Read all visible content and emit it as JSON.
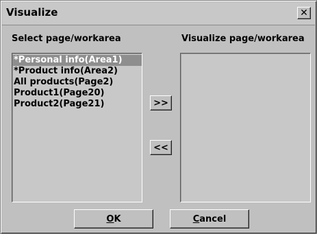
{
  "window": {
    "title": "Visualize",
    "close_icon": "close-icon"
  },
  "left_panel": {
    "label": "Select page/workarea",
    "items": [
      {
        "label": "*Personal info(Area1)",
        "selected": true
      },
      {
        "label": "*Product info(Area2)",
        "selected": false
      },
      {
        "label": "All products(Page2)",
        "selected": false
      },
      {
        "label": "Product1(Page20)",
        "selected": false
      },
      {
        "label": "Product2(Page21)",
        "selected": false
      }
    ]
  },
  "right_panel": {
    "label": "Visualize page/workarea",
    "items": []
  },
  "buttons": {
    "add": ">>",
    "remove": "<<",
    "ok_mnemonic": "O",
    "ok_rest": "K",
    "cancel_mnemonic": "C",
    "cancel_rest": "ancel"
  },
  "colors": {
    "face": "#c0c0c0",
    "selection": "#8e8e8e"
  }
}
